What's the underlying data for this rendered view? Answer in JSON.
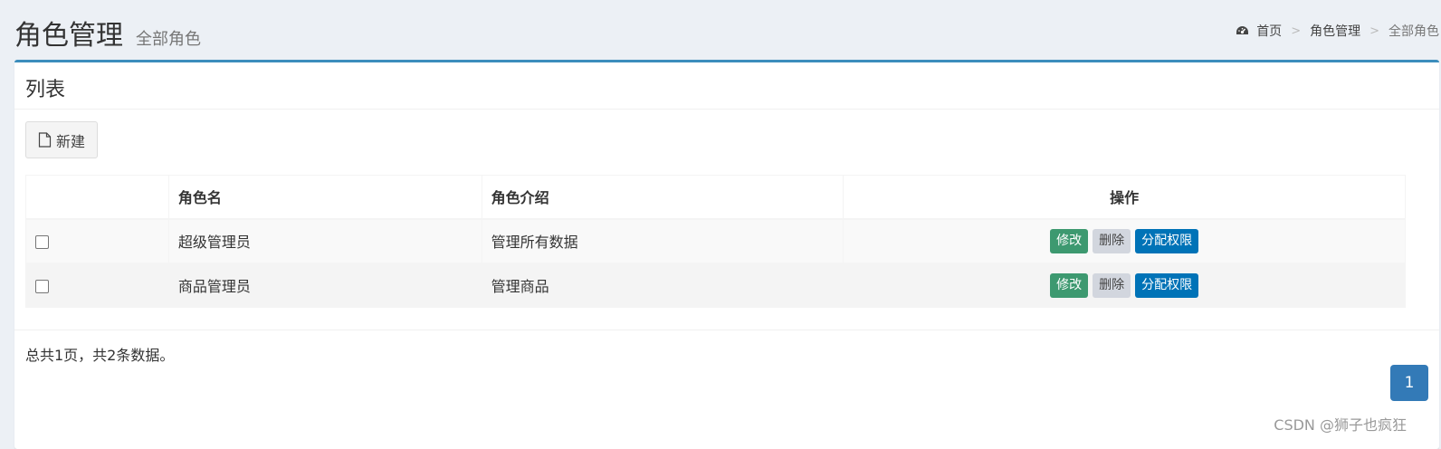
{
  "header": {
    "title": "角色管理",
    "subtitle": "全部角色"
  },
  "breadcrumb": {
    "home": "首页",
    "items": [
      "角色管理",
      "全部角色"
    ],
    "separator": ">",
    "icon": "dashboard-icon"
  },
  "panel": {
    "title": "列表",
    "new_button": "新建",
    "new_icon": "file-icon"
  },
  "table": {
    "columns": [
      "",
      "角色名",
      "角色介绍",
      "操作"
    ],
    "rows": [
      {
        "checked": false,
        "name": "超级管理员",
        "description": "管理所有数据",
        "actions": [
          "修改",
          "删除",
          "分配权限"
        ]
      },
      {
        "checked": false,
        "name": "商品管理员",
        "description": "管理商品",
        "actions": [
          "修改",
          "删除",
          "分配权限"
        ]
      }
    ]
  },
  "footer": {
    "summary": "总共1页，共2条数据。",
    "current_page": "1"
  },
  "watermark": "CSDN @狮子也疯狂",
  "colors": {
    "accent": "#3c8dbc",
    "edit": "#3d9970",
    "delete": "#d2d6de",
    "permission": "#0073b7",
    "pager": "#337ab7"
  }
}
